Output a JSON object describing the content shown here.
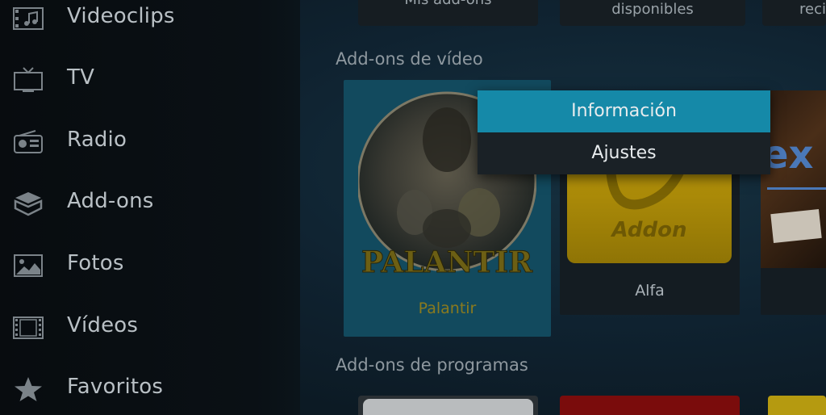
{
  "sidebar": {
    "items": [
      {
        "label": "Videoclips",
        "icon": "music-video-icon"
      },
      {
        "label": "TV",
        "icon": "tv-icon"
      },
      {
        "label": "Radio",
        "icon": "radio-icon"
      },
      {
        "label": "Add-ons",
        "icon": "box-icon"
      },
      {
        "label": "Fotos",
        "icon": "photo-icon"
      },
      {
        "label": "Vídeos",
        "icon": "film-icon"
      },
      {
        "label": "Favoritos",
        "icon": "star-icon"
      }
    ]
  },
  "top_row": {
    "tiles": [
      {
        "label": "Mis add-ons"
      },
      {
        "label": "disponibles"
      },
      {
        "label": "reci"
      }
    ]
  },
  "sections": {
    "video_addons_title": "Add-ons de vídeo",
    "program_addons_title": "Add-ons de programas"
  },
  "video_addons": [
    {
      "name": "Palantir",
      "art_text": "PALANTIR"
    },
    {
      "name": "Alfa",
      "art_text": "Addon"
    }
  ],
  "third_tile": {
    "art_text": "ex"
  },
  "context_menu": {
    "items": [
      {
        "label": "Información",
        "selected": true
      },
      {
        "label": "Ajustes",
        "selected": false
      }
    ]
  },
  "colors": {
    "accent": "#1589a8",
    "selected_tile": "#124a5e",
    "palantir_text": "#8a7a1e",
    "alfa_gold": "#b8950a"
  }
}
